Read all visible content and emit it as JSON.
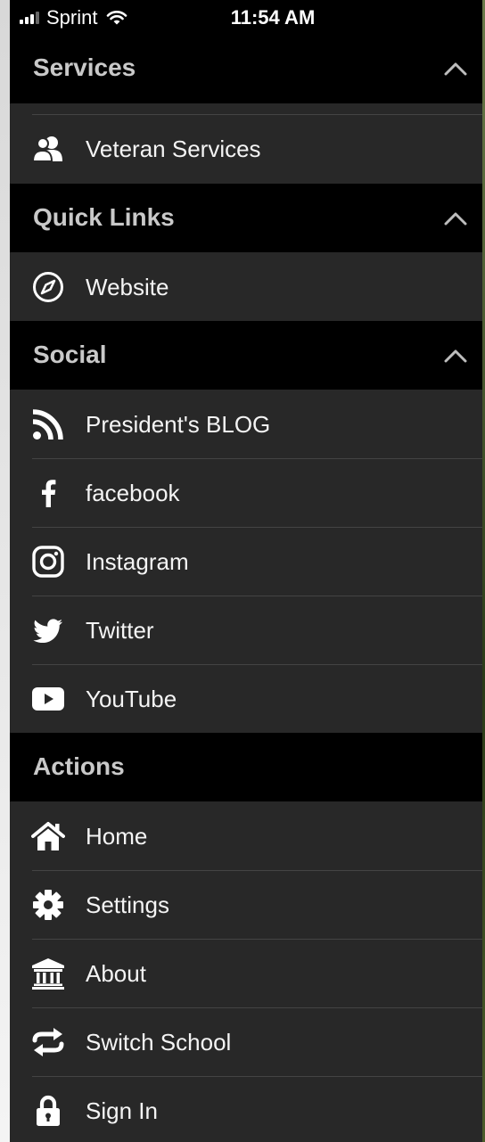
{
  "status_bar": {
    "carrier": "Sprint",
    "time": "11:54 AM"
  },
  "sections": {
    "services": {
      "title": "Services",
      "items": [
        {
          "label": "Veteran Services",
          "icon": "users-icon"
        }
      ]
    },
    "quick_links": {
      "title": "Quick Links",
      "items": [
        {
          "label": "Website",
          "icon": "compass-icon"
        }
      ]
    },
    "social": {
      "title": "Social",
      "items": [
        {
          "label": "President's BLOG",
          "icon": "rss-icon"
        },
        {
          "label": "facebook",
          "icon": "facebook-icon"
        },
        {
          "label": "Instagram",
          "icon": "instagram-icon"
        },
        {
          "label": "Twitter",
          "icon": "twitter-icon"
        },
        {
          "label": "YouTube",
          "icon": "youtube-icon"
        }
      ]
    },
    "actions": {
      "title": "Actions",
      "items": [
        {
          "label": "Home",
          "icon": "home-icon"
        },
        {
          "label": "Settings",
          "icon": "gear-icon"
        },
        {
          "label": "About",
          "icon": "institution-icon"
        },
        {
          "label": "Switch School",
          "icon": "switch-icon"
        },
        {
          "label": "Sign In",
          "icon": "lock-icon"
        }
      ]
    }
  },
  "colors": {
    "header_bg": "#000000",
    "row_bg": "#282828",
    "header_text": "#c9c9c9",
    "row_text": "#f4f4f4",
    "divider": "#444444"
  }
}
